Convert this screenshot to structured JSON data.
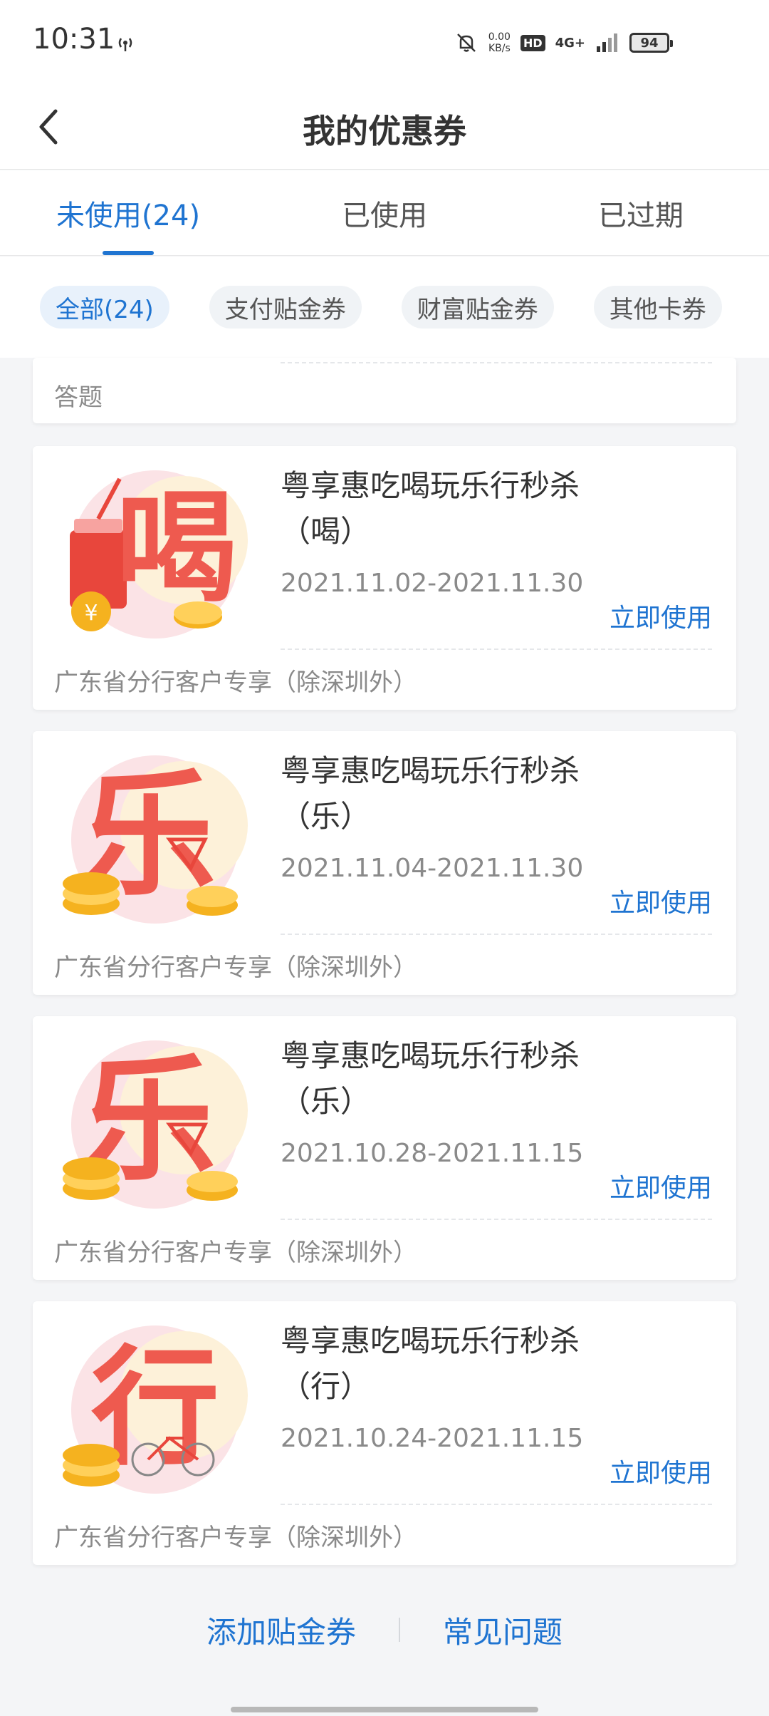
{
  "status_bar": {
    "time": "10:31",
    "speed_value": "0.00",
    "speed_unit": "KB/s",
    "hd": "HD",
    "network": "4G+",
    "battery": "94"
  },
  "header": {
    "title": "我的优惠券"
  },
  "tabs": [
    {
      "label": "未使用(24)",
      "active": true
    },
    {
      "label": "已使用",
      "active": false
    },
    {
      "label": "已过期",
      "active": false
    }
  ],
  "filters": [
    {
      "label": "全部(24)",
      "active": true
    },
    {
      "label": "支付贴金券",
      "active": false
    },
    {
      "label": "财富贴金券",
      "active": false
    },
    {
      "label": "其他卡券",
      "active": false
    }
  ],
  "partial_card": {
    "text": "答题"
  },
  "coupons": [
    {
      "title_line1": "粤享惠吃喝玩乐行秒杀",
      "title_line2": "（喝）",
      "dates": "2021.11.02-2021.11.30",
      "action": "立即使用",
      "scope": "广东省分行客户专享（除深圳外）",
      "glyph": "喝"
    },
    {
      "title_line1": "粤享惠吃喝玩乐行秒杀",
      "title_line2": "（乐）",
      "dates": "2021.11.04-2021.11.30",
      "action": "立即使用",
      "scope": "广东省分行客户专享（除深圳外）",
      "glyph": "乐"
    },
    {
      "title_line1": "粤享惠吃喝玩乐行秒杀",
      "title_line2": "（乐）",
      "dates": "2021.10.28-2021.11.15",
      "action": "立即使用",
      "scope": "广东省分行客户专享（除深圳外）",
      "glyph": "乐"
    },
    {
      "title_line1": "粤享惠吃喝玩乐行秒杀",
      "title_line2": "（行）",
      "dates": "2021.10.24-2021.11.15",
      "action": "立即使用",
      "scope": "广东省分行客户专享（除深圳外）",
      "glyph": "行"
    }
  ],
  "footer": {
    "add_label": "添加贴金券",
    "faq_label": "常见问题"
  },
  "colors": {
    "accent": "#1f74d1",
    "coupon_red": "#e8463c",
    "coin_gold": "#f5b21f"
  }
}
